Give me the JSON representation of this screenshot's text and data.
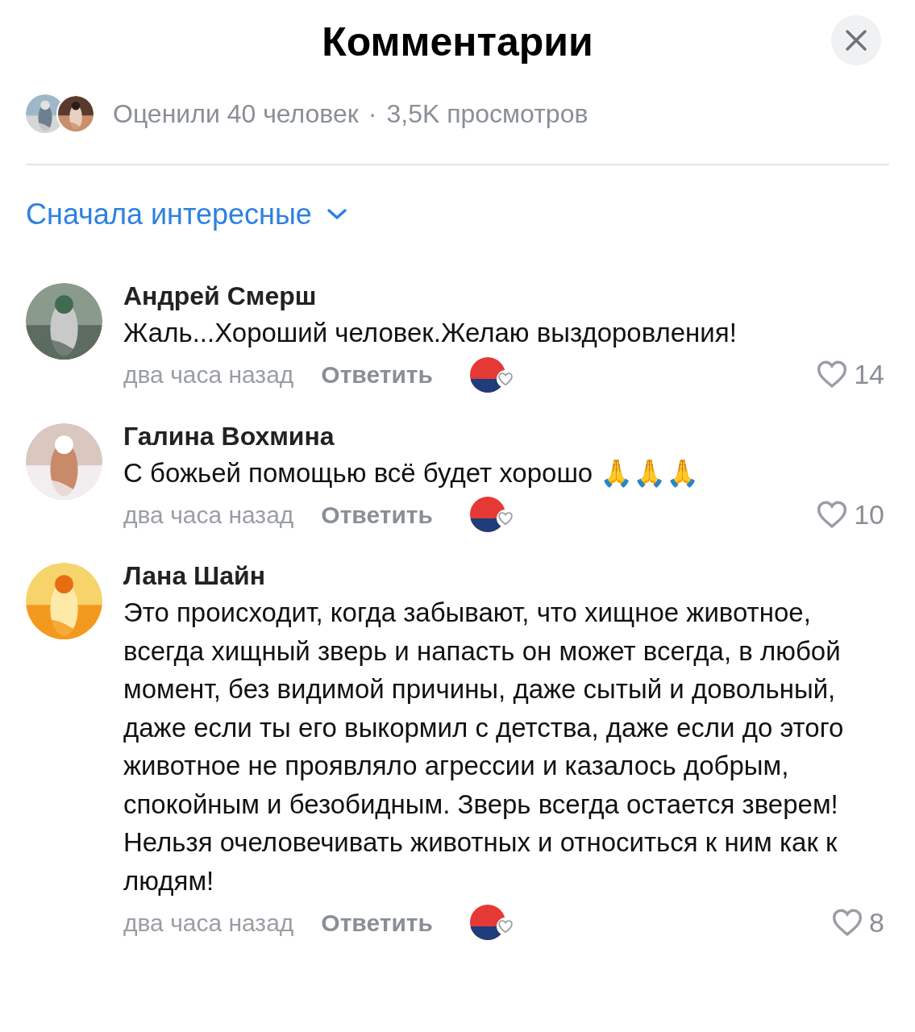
{
  "header": {
    "title": "Комментарии"
  },
  "stats": {
    "likes": "Оценили 40 человек",
    "separator": "·",
    "views": "3,5K просмотров"
  },
  "sort": {
    "label": "Сначала интересные"
  },
  "comments": [
    {
      "author": "Андрей Смерш",
      "text": "Жаль...Хороший человек.Желаю выздоровления!",
      "time": "два часа назад",
      "reply": "Ответить",
      "likes": "14",
      "author_liked": true
    },
    {
      "author": "Галина Вохмина",
      "text": "С божьей помощью всё будет хорошо 🙏🙏🙏",
      "time": "два часа назад",
      "reply": "Ответить",
      "likes": "10",
      "author_liked": true
    },
    {
      "author": "Лана Шайн",
      "text": "Это происходит, когда забывают, что хищное животное, всегда хищный зверь и напасть он может всегда, в любой момент, без видимой причины, даже сытый и довольный, даже если ты его выкормил с детства, даже если до этого животное не проявляло агрессии и казалось добрым, спокойным и безобидным. Зверь всегда остается зверем! Нельзя очеловечивать животных и относиться к ним как к людям!",
      "time": "два часа назад",
      "reply": "Ответить",
      "likes": "8",
      "author_liked": true
    }
  ]
}
